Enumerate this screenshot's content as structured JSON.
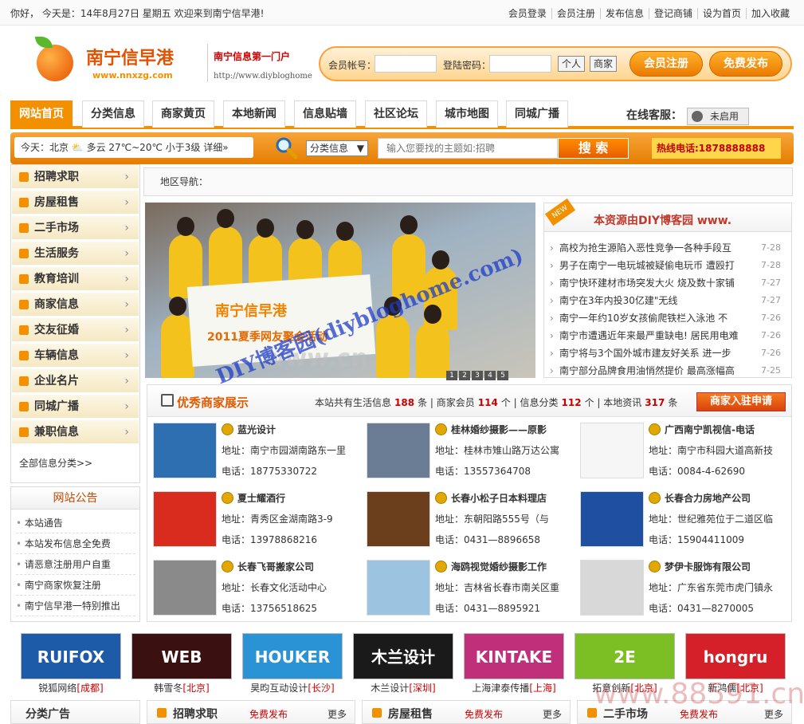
{
  "topbar": {
    "greeting": "你好， 今天是：14年8月27日 星期五  欢迎来到南宁信早港!",
    "links": [
      "会员登录",
      "会员注册",
      "发布信息",
      "登记商铺",
      "设为首页",
      "加入收藏"
    ]
  },
  "header": {
    "logo_text": "南宁信早港",
    "logo_url": "www.nnxzg.com",
    "slogan": "南宁信息第一门户",
    "site_url": "http://www.diybloghome",
    "login": {
      "account_label": "会员帐号：",
      "password_label": "登陆密码：",
      "personal_btn": "个人",
      "merchant_btn": "商家",
      "register_btn": "会员注册",
      "publish_btn": "免费发布"
    }
  },
  "nav": {
    "items": [
      "网站首页",
      "分类信息",
      "商家黄页",
      "本地新闻",
      "信息贴墙",
      "社区论坛",
      "城市地图",
      "同城广播"
    ],
    "service_label": "在线客服：",
    "service_status": "未启用"
  },
  "search": {
    "weather": "今天：北京 ⛅ 多云  27℃~20℃ 小于3级  详细»",
    "category": "分类信息",
    "placeholder": "输入您要找的主题如:招聘",
    "button": "搜 索",
    "hotline": "热线电话:1878888888"
  },
  "sidebar": {
    "items": [
      "招聘求职",
      "房屋租售",
      "二手市场",
      "生活服务",
      "教育培训",
      "商家信息",
      "交友征婚",
      "车辆信息",
      "企业名片",
      "同城广播",
      "兼职信息"
    ],
    "all_categories": "全部信息分类>>",
    "notice_title": "网站公告",
    "notices": [
      "本站通告",
      "本站发布信息全免费",
      "请恶意注册用户自重",
      "南宁商家恢复注册",
      "南宁信早港一特别推出"
    ]
  },
  "region_label": "地区导航：",
  "banner": {
    "flag_text": "南宁信早港",
    "flag_sub": "2011夏季网友聚会活动",
    "dots": [
      "1",
      "2",
      "3",
      "4",
      "5"
    ]
  },
  "news": {
    "new_tag": "NEW",
    "title": "本资源由DIY博客园 www.",
    "items": [
      {
        "title": "高校为抢生源陷入恶性竞争一各种手段互",
        "date": "7-28"
      },
      {
        "title": "男子在南宁一电玩城被疑偷电玩币 遭殴打",
        "date": "7-28"
      },
      {
        "title": "南宁快环建材市场突发大火 烧及数十家铺",
        "date": "7-27"
      },
      {
        "title": "南宁在3年内投30亿建\"无线",
        "date": "7-27"
      },
      {
        "title": "南宁一年约10岁女孩偷爬铁栏入泳池 不",
        "date": "7-26"
      },
      {
        "title": "南宁市遭遇近年来最严重缺电! 居民用电难",
        "date": "7-26"
      },
      {
        "title": "南宁将与3个国外城市建友好关系 进一步",
        "date": "7-26"
      },
      {
        "title": "南宁部分品牌食用油悄然提价 最高涨幅高",
        "date": "7-25"
      }
    ]
  },
  "merchants": {
    "title": "优秀商家展示",
    "stats_prefix": "本站共有生活信息",
    "info_count": "188",
    "member_label": "条 | 商家会员",
    "member_count": "114",
    "cat_label": "个 | 信息分类",
    "cat_count": "112",
    "news_label": "个 | 本地资讯",
    "news_count": "317",
    "stats_suffix": "条",
    "apply_btn": "商家入驻申请",
    "cards": [
      {
        "name": "蓝光设计",
        "addr": "地址：南宁市园湖南路东一里",
        "tel": "电话：18775330722",
        "color": "#2d6fb0"
      },
      {
        "name": "桂林婚纱摄影——原影",
        "addr": "地址：桂林市雉山路万达公寓",
        "tel": "电话：13557364708",
        "color": "#6a7d95"
      },
      {
        "name": "广西南宁凯视信-电话",
        "addr": "地址：南宁市科园大道高新技",
        "tel": "电话：0084-4-62690",
        "color": "#f6f6f6"
      },
      {
        "name": "夏士耀酒行",
        "addr": "地址：青秀区金湖南路3-9",
        "tel": "电话：13978868216",
        "color": "#d92b1e"
      },
      {
        "name": "长春小松子日本料理店",
        "addr": "地址：东朝阳路555号（与",
        "tel": "电话：0431—8896658",
        "color": "#6b3f1c"
      },
      {
        "name": "长春合力房地产公司",
        "addr": "地址：世纪雅苑位于二道区临",
        "tel": "电话：15904411009",
        "color": "#1e4fa0"
      },
      {
        "name": "长春飞哥搬家公司",
        "addr": "地址：长春文化活动中心",
        "tel": "电话：13756518625",
        "color": "#8a8a8a"
      },
      {
        "name": "海鸥视觉婚纱摄影工作",
        "addr": "地址：吉林省长春市南关区重",
        "tel": "电话：0431—8895921",
        "color": "#9cc3e0"
      },
      {
        "name": "梦伊卡服饰有限公司",
        "addr": "地址：广东省东莞市虎门镇永",
        "tel": "电话：0431—8270005",
        "color": "#d8d8d8"
      }
    ]
  },
  "logos": [
    {
      "brand": "RUIFOX",
      "name": "锐狐网络",
      "city": "[成都]",
      "bg": "#1d5aa8"
    },
    {
      "brand": "WEB",
      "name": "韩雪冬",
      "city": "[北京]",
      "bg": "#3a1010"
    },
    {
      "brand": "HOUKER",
      "name": "昊昀互动设计",
      "city": "[长沙]",
      "bg": "#2a93d6"
    },
    {
      "brand": "木兰设计",
      "name": "木兰设计",
      "city": "[深圳]",
      "bg": "#1a1a1a"
    },
    {
      "brand": "KINTAKE",
      "name": "上海津泰传播",
      "city": "[上海]",
      "bg": "#c0307a"
    },
    {
      "brand": "2E",
      "name": "拓意创新",
      "city": "[北京]",
      "bg": "#7cbf24"
    },
    {
      "brand": "hongru",
      "name": "新鸿儒",
      "city": "[北京]",
      "bg": "#d5202a"
    }
  ],
  "bottom": {
    "ad_title": "分类广告",
    "boxes": [
      {
        "title": "招聘求职",
        "publish": "免费发布",
        "more": "更多"
      },
      {
        "title": "房屋租售",
        "publish": "免费发布",
        "more": "更多"
      },
      {
        "title": "二手市场",
        "publish": "免费发布",
        "more": "更多"
      }
    ]
  },
  "watermarks": {
    "blog": "DIY博客园(diybloghome.com)",
    "site": "www.88591.cn",
    "gray": "www.cn"
  }
}
